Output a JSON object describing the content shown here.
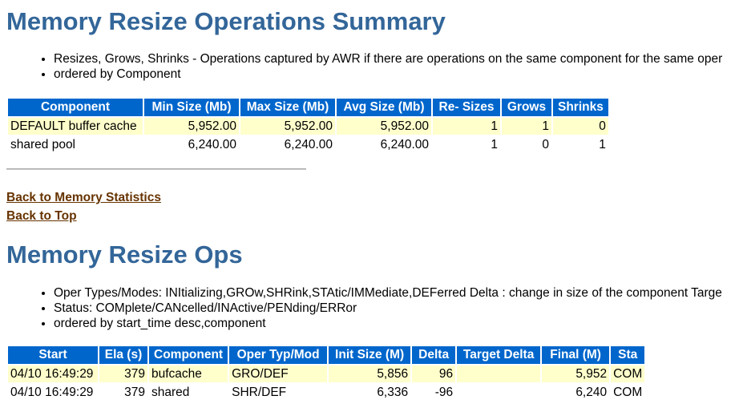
{
  "summary": {
    "title": "Memory Resize Operations Summary",
    "notes": [
      "Resizes, Grows, Shrinks - Operations captured by AWR if there are operations on the same component for the same oper",
      "ordered by Component"
    ],
    "headers": [
      "Component",
      "Min Size (Mb)",
      "Max Size (Mb)",
      "Avg Size (Mb)",
      "Re- Sizes",
      "Grows",
      "Shrinks"
    ],
    "rows": [
      [
        "DEFAULT buffer cache",
        "5,952.00",
        "5,952.00",
        "5,952.00",
        "1",
        "1",
        "0"
      ],
      [
        "shared pool",
        "6,240.00",
        "6,240.00",
        "6,240.00",
        "1",
        "0",
        "1"
      ]
    ]
  },
  "links": {
    "memory_statistics": "Back to Memory Statistics",
    "top": "Back to Top"
  },
  "ops": {
    "title": "Memory Resize Ops",
    "notes": [
      "Oper Types/Modes: INItializing,GROw,SHRink,STAtic/IMMediate,DEFerred Delta : change in size of the component Targe",
      "Status: COMplete/CANcelled/INActive/PENding/ERRor",
      "ordered by start_time desc,component"
    ],
    "headers": [
      "Start",
      "Ela (s)",
      "Component",
      "Oper Typ/Mod",
      "Init Size (M)",
      "Delta",
      "Target Delta",
      "Final (M)",
      "Sta"
    ],
    "rows": [
      [
        "04/10 16:49:29",
        "379",
        "bufcache",
        "GRO/DEF",
        "5,856",
        "96",
        "",
        "5,952",
        "COM"
      ],
      [
        "04/10 16:49:29",
        "379",
        "shared",
        "SHR/DEF",
        "6,336",
        "-96",
        "",
        "6,240",
        "COM"
      ]
    ]
  },
  "colors": {
    "heading": "#336699",
    "header_bg": "#0066cc",
    "row_highlight": "#ffffcc",
    "link": "#663300"
  }
}
